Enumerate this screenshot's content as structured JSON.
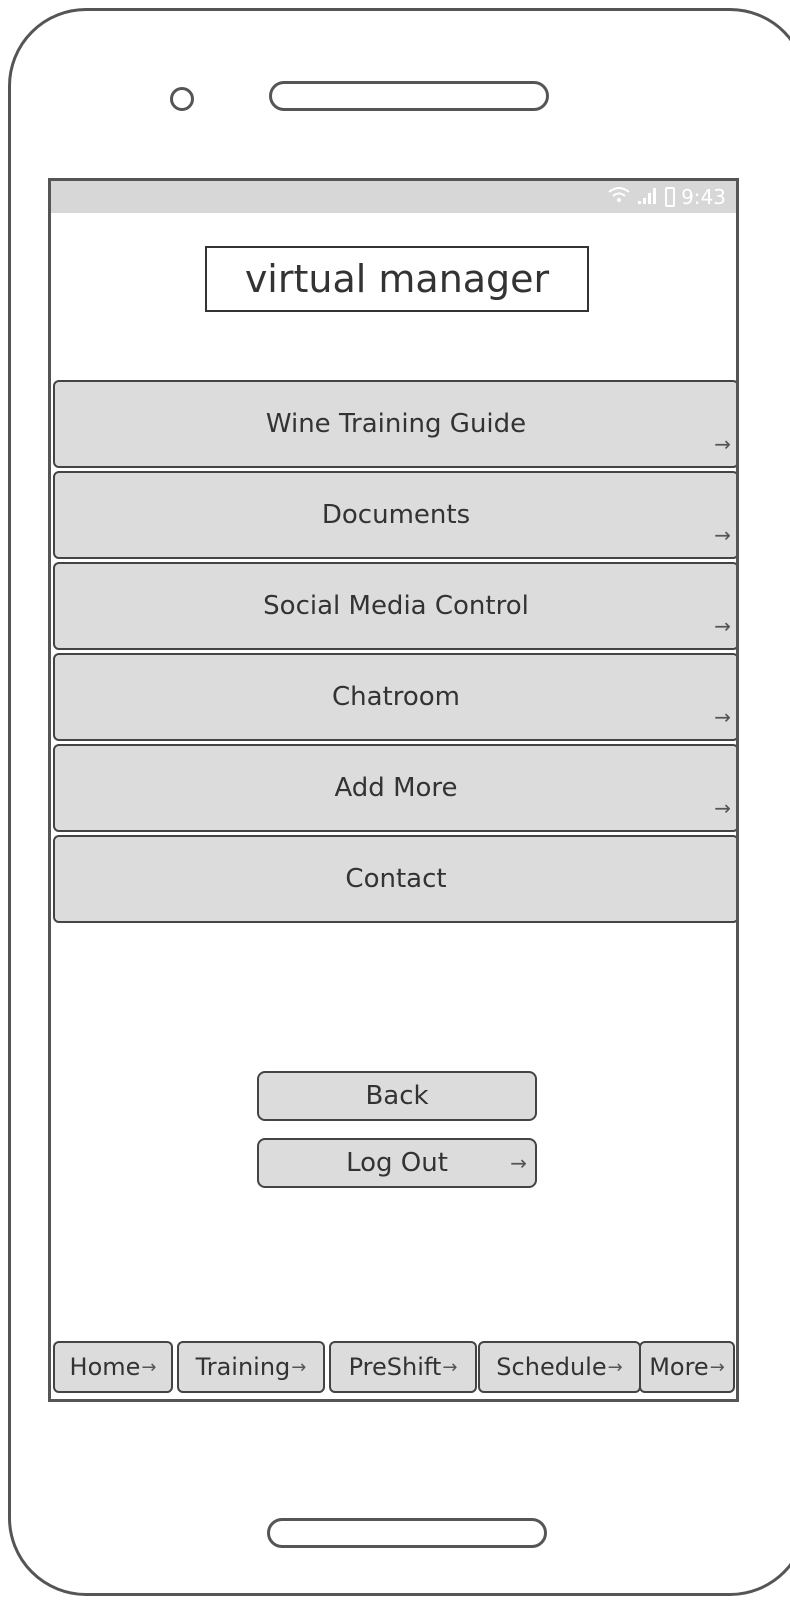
{
  "status_bar": {
    "time": "9:43",
    "wifi_icon": "wifi-icon",
    "signal_icon": "signal-icon",
    "battery_icon": "battery-icon"
  },
  "app": {
    "title": "virtual manager"
  },
  "menu": {
    "items": [
      {
        "label": "Wine Training Guide",
        "arrow": "→"
      },
      {
        "label": "Documents",
        "arrow": "→"
      },
      {
        "label": "Social Media Control",
        "arrow": "→"
      },
      {
        "label": "Chatroom",
        "arrow": "→"
      },
      {
        "label": "Add More",
        "arrow": "→"
      },
      {
        "label": "Contact",
        "arrow": ""
      }
    ]
  },
  "actions": {
    "back_label": "Back",
    "logout_label": "Log Out",
    "logout_arrow": "→"
  },
  "tabbar": {
    "tabs": [
      {
        "label": "Home",
        "arrow": "→"
      },
      {
        "label": "Training",
        "arrow": "→"
      },
      {
        "label": "PreShift",
        "arrow": "→"
      },
      {
        "label": "Schedule",
        "arrow": "→"
      },
      {
        "label": "More",
        "arrow": "→"
      }
    ]
  }
}
